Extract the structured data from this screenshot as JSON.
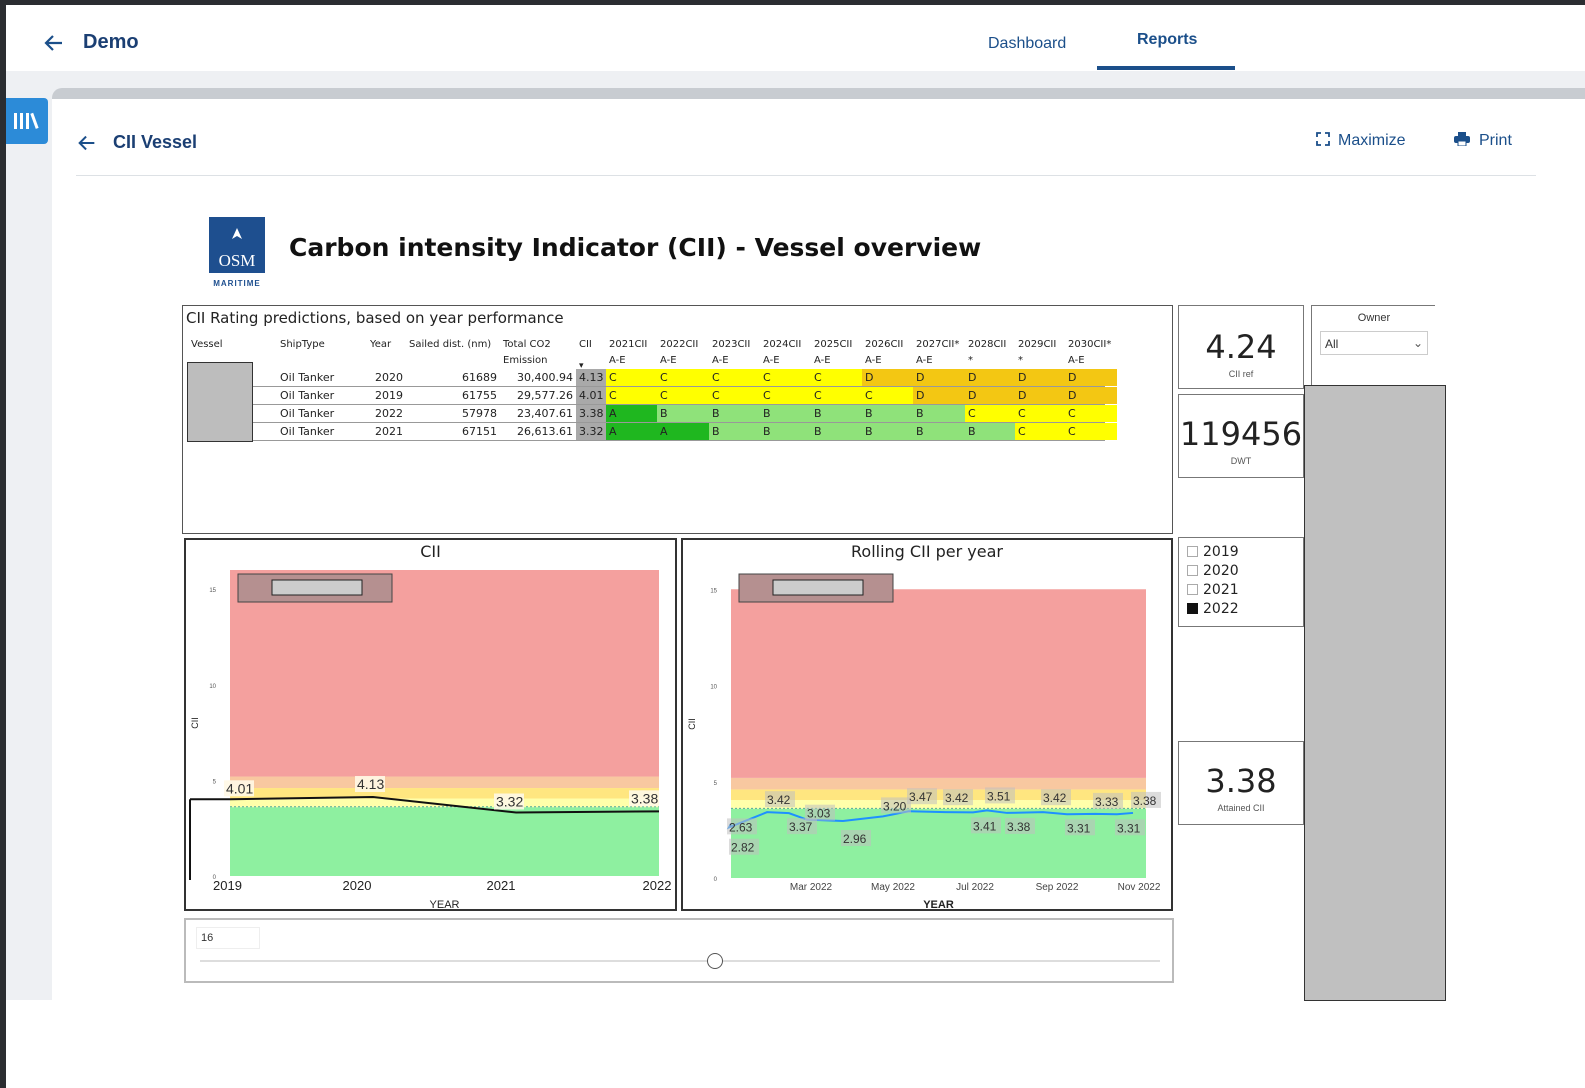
{
  "app": {
    "back_icon": "arrow-left-icon",
    "title": "Demo",
    "tabs": {
      "dashboard": "Dashboard",
      "reports": "Reports"
    },
    "active_tab": "Reports"
  },
  "sidebar": {
    "library_icon": "library-icon"
  },
  "report": {
    "back_icon": "arrow-left-icon",
    "title": "CII Vessel",
    "maximize_label": "Maximize",
    "print_label": "Print"
  },
  "logo": {
    "name": "OSM",
    "subtitle": "MARITIME"
  },
  "heading": "Carbon intensity Indicator (CII) - Vessel overview",
  "table": {
    "title": "CII Rating predictions, based on year performance",
    "columns": [
      "Vessel",
      "ShipType",
      "Year",
      "Sailed dist. (nm)",
      "Total CO2 Emission",
      "CII",
      "2021CII A-E",
      "2022CII A-E",
      "2023CII A-E",
      "2024CII A-E",
      "2025CII A-E",
      "2026CII A-E",
      "2027CII* A-E",
      "2028CII * A-E",
      "2029CII * A-E",
      "2030CII* A-E"
    ],
    "rows": [
      {
        "shiptype": "Oil Tanker",
        "year": "2020",
        "dist": "61689",
        "co2": "30,400.94",
        "cii": "4.13",
        "ratings": [
          "C",
          "C",
          "C",
          "C",
          "C",
          "D",
          "D",
          "D",
          "D",
          "D"
        ]
      },
      {
        "shiptype": "Oil Tanker",
        "year": "2019",
        "dist": "61755",
        "co2": "29,577.26",
        "cii": "4.01",
        "ratings": [
          "C",
          "C",
          "C",
          "C",
          "C",
          "C",
          "D",
          "D",
          "D",
          "D"
        ]
      },
      {
        "shiptype": "Oil Tanker",
        "year": "2022",
        "dist": "57978",
        "co2": "23,407.61",
        "cii": "3.38",
        "ratings": [
          "A",
          "B",
          "B",
          "B",
          "B",
          "B",
          "B",
          "C",
          "C",
          "C"
        ]
      },
      {
        "shiptype": "Oil Tanker",
        "year": "2021",
        "dist": "67151",
        "co2": "26,613.61",
        "cii": "3.32",
        "ratings": [
          "A",
          "A",
          "B",
          "B",
          "B",
          "B",
          "B",
          "B",
          "C",
          "C"
        ]
      }
    ],
    "rating_colors": {
      "A": "#1fb71f",
      "B": "#8fe27a",
      "C": "#ffff00",
      "D": "#f3c713"
    }
  },
  "kpis": {
    "cii_ref": {
      "value": "4.24",
      "label": "CII ref"
    },
    "dwt": {
      "value": "119456",
      "label": "DWT"
    },
    "attained": {
      "value": "3.38",
      "label": "Attained CII"
    }
  },
  "owner_filter": {
    "title": "Owner",
    "value": "All"
  },
  "year_filter": {
    "options": [
      {
        "label": "2019",
        "checked": false
      },
      {
        "label": "2020",
        "checked": false
      },
      {
        "label": "2021",
        "checked": false
      },
      {
        "label": "2022",
        "checked": true
      }
    ]
  },
  "slider": {
    "value": "16"
  },
  "chart_data": [
    {
      "type": "line",
      "title": "CII",
      "xlabel": "YEAR",
      "ylabel": "CII",
      "x": [
        "2019",
        "2020",
        "2021",
        "2022"
      ],
      "series": [
        {
          "values": [
            4.01,
            4.13,
            3.32,
            3.38
          ]
        }
      ],
      "data_labels": [
        "4.01",
        "4.13",
        "3.32",
        "3.38"
      ],
      "ylim": [
        0,
        16
      ],
      "yticks": [
        "0",
        "5",
        "10",
        "15"
      ],
      "bands": [
        {
          "color": "#8ef0a0"
        },
        {
          "color": "#ffffaa"
        },
        {
          "color": "#ffe680"
        },
        {
          "color": "#f8c8a0"
        },
        {
          "color": "#f4a09e"
        }
      ],
      "colors": {
        "line": "#111111"
      }
    },
    {
      "type": "line",
      "title": "Rolling CII per year",
      "xlabel": "YEAR",
      "ylabel": "CII",
      "xticks": [
        "Mar 2022",
        "May 2022",
        "Jul 2022",
        "Sep 2022",
        "Nov 2022"
      ],
      "series": [
        {
          "values": [
            2.82,
            2.63,
            3.42,
            3.37,
            3.03,
            2.96,
            3.2,
            3.47,
            3.42,
            3.41,
            3.51,
            3.38,
            3.42,
            3.31,
            3.33,
            3.31,
            3.38
          ]
        }
      ],
      "data_labels": [
        "2.82",
        "2.63",
        "3.42",
        "3.37",
        "3.03",
        "2.96",
        "3.20",
        "3.47",
        "3.42",
        "3.41",
        "3.51",
        "3.38",
        "3.42",
        "3.31",
        "3.33",
        "3.31",
        "3.38"
      ],
      "ylim": [
        0,
        16
      ],
      "yticks": [
        "0",
        "5",
        "10",
        "15"
      ],
      "colors": {
        "line": "#1e90ff"
      }
    }
  ]
}
